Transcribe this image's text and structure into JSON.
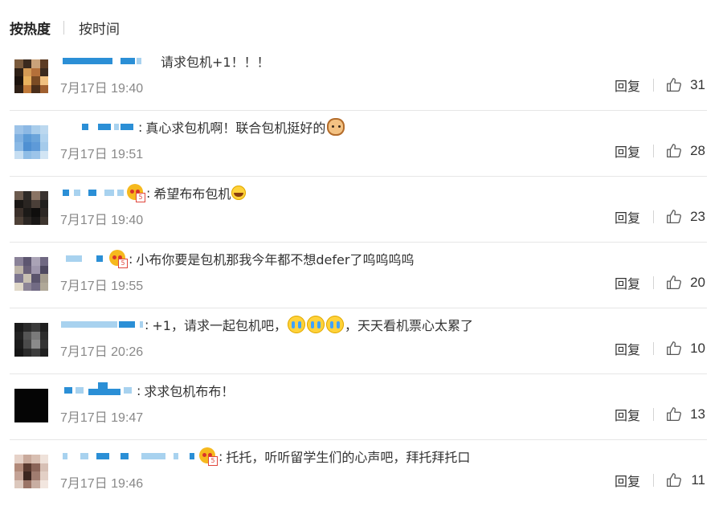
{
  "sort_tabs": {
    "hot": "按热度",
    "time": "按时间"
  },
  "actions": {
    "reply_label": "回复"
  },
  "comments": [
    {
      "content": "请求包机+1！！！",
      "time": "7月17日 19:40",
      "likes": "31",
      "avatar_colors": [
        "#7a5a3c",
        "#3b2a1e",
        "#caa27a",
        "#5c3b24",
        "#2e2016",
        "#d49a55",
        "#b4703a",
        "#3b2a1e",
        "#1c130d",
        "#e8b15e",
        "#7a4b24",
        "#f0c080",
        "#2e2016",
        "#c07a3a",
        "#4a2e1a",
        "#a06030"
      ]
    },
    {
      "content": "真心求包机啊！联合包机挺好的",
      "time": "7月17日 19:51",
      "likes": "28",
      "avatar_colors": [
        "#9dc3e8",
        "#8cb8e4",
        "#a9cdeb",
        "#bcd8ef",
        "#7fb0e0",
        "#5b9ad6",
        "#6aa4da",
        "#b0d2ee",
        "#8ab9e5",
        "#4f90d2",
        "#5e9ad8",
        "#a5cbeb",
        "#c6def2",
        "#8fbde6",
        "#9cc4e9",
        "#d2e5f4"
      ]
    },
    {
      "content": "希望布布包机",
      "time": "7月17日 19:40",
      "likes": "23",
      "avatar_colors": [
        "#6b5a4e",
        "#2e2a27",
        "#8a7464",
        "#3a3330",
        "#1a1715",
        "#2a2522",
        "#4a3f38",
        "#21201e",
        "#3b302a",
        "#1c1a18",
        "#0f0e0d",
        "#2c2724",
        "#4e4137",
        "#2b2623",
        "#191716",
        "#3d342e"
      ]
    },
    {
      "content": "小布你要是包机那我今年都不想defer了呜呜呜呜",
      "time": "7月17日 19:55",
      "likes": "20",
      "avatar_colors": [
        "#8a8298",
        "#5d5670",
        "#aaa3b6",
        "#6f6882",
        "#bdb4a8",
        "#6a6178",
        "#9e96ac",
        "#4e4960",
        "#7d7690",
        "#c8c0b2",
        "#5a546c",
        "#a49c8e",
        "#e0d8c8",
        "#8c8496",
        "#726b84",
        "#b0a898"
      ]
    },
    {
      "content": "+1，请求一起包机吧，",
      "content_tail": "，天天看机票心太累了",
      "time": "7月17日 20:26",
      "likes": "10",
      "avatar_colors": [
        "#1a1a1a",
        "#2a2a2a",
        "#3a3a3a",
        "#1f1f1f",
        "#222",
        "#555",
        "#7a7a7a",
        "#2c2c2c",
        "#1b1b1b",
        "#4a4a4a",
        "#8a8a8a",
        "#333",
        "#161616",
        "#2a2a2a",
        "#3d3d3d",
        "#202020"
      ]
    },
    {
      "content": "求求包机布布！",
      "time": "7月17日 19:47",
      "likes": "13",
      "avatar_colors": [
        "#050505",
        "#050505",
        "#050505",
        "#050505",
        "#050505",
        "#050505",
        "#050505",
        "#050505",
        "#050505",
        "#050505",
        "#050505",
        "#050505",
        "#050505",
        "#050505",
        "#050505",
        "#050505"
      ]
    },
    {
      "content": "托托，听听留学生们的心声吧，拜托拜托口",
      "time": "7月17日 19:46",
      "likes": "11",
      "avatar_colors": [
        "#e6d2c8",
        "#c9aa9c",
        "#d8bfb2",
        "#efe2da",
        "#b28a7a",
        "#5a3a30",
        "#8a6458",
        "#d7c0b5",
        "#c4a396",
        "#3c2620",
        "#a07c70",
        "#e3d0c6",
        "#dcc8bd",
        "#9a7466",
        "#c8aea2",
        "#f2e6df"
      ]
    }
  ]
}
